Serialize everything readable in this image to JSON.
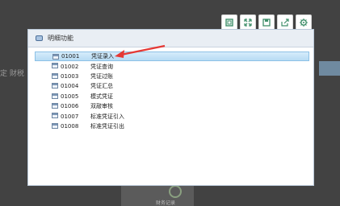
{
  "background": {
    "left_text": "定 财税",
    "card_label": "财务记录"
  },
  "toolbar": {
    "buttons": [
      {
        "name": "restore-window",
        "icon": "window-icon"
      },
      {
        "name": "fullscreen",
        "icon": "expand-icon"
      },
      {
        "name": "save",
        "icon": "save-icon"
      },
      {
        "name": "export",
        "icon": "export-icon"
      },
      {
        "name": "settings",
        "icon": "gear-icon"
      }
    ]
  },
  "dialog": {
    "title": "明细功能",
    "items": [
      {
        "code": "01001",
        "label": "凭证录入",
        "selected": true
      },
      {
        "code": "01002",
        "label": "凭证查询",
        "selected": false
      },
      {
        "code": "01003",
        "label": "凭证过账",
        "selected": false
      },
      {
        "code": "01004",
        "label": "凭证汇总",
        "selected": false
      },
      {
        "code": "01005",
        "label": "模式凭证",
        "selected": false
      },
      {
        "code": "01006",
        "label": "双敲审核",
        "selected": false
      },
      {
        "code": "01007",
        "label": "标准凭证引入",
        "selected": false
      },
      {
        "code": "01008",
        "label": "标准凭证引出",
        "selected": false
      }
    ]
  },
  "colors": {
    "accent": "#4c6f98",
    "selected_row": "#b7dbf4",
    "annotation_arrow": "#e53935"
  }
}
